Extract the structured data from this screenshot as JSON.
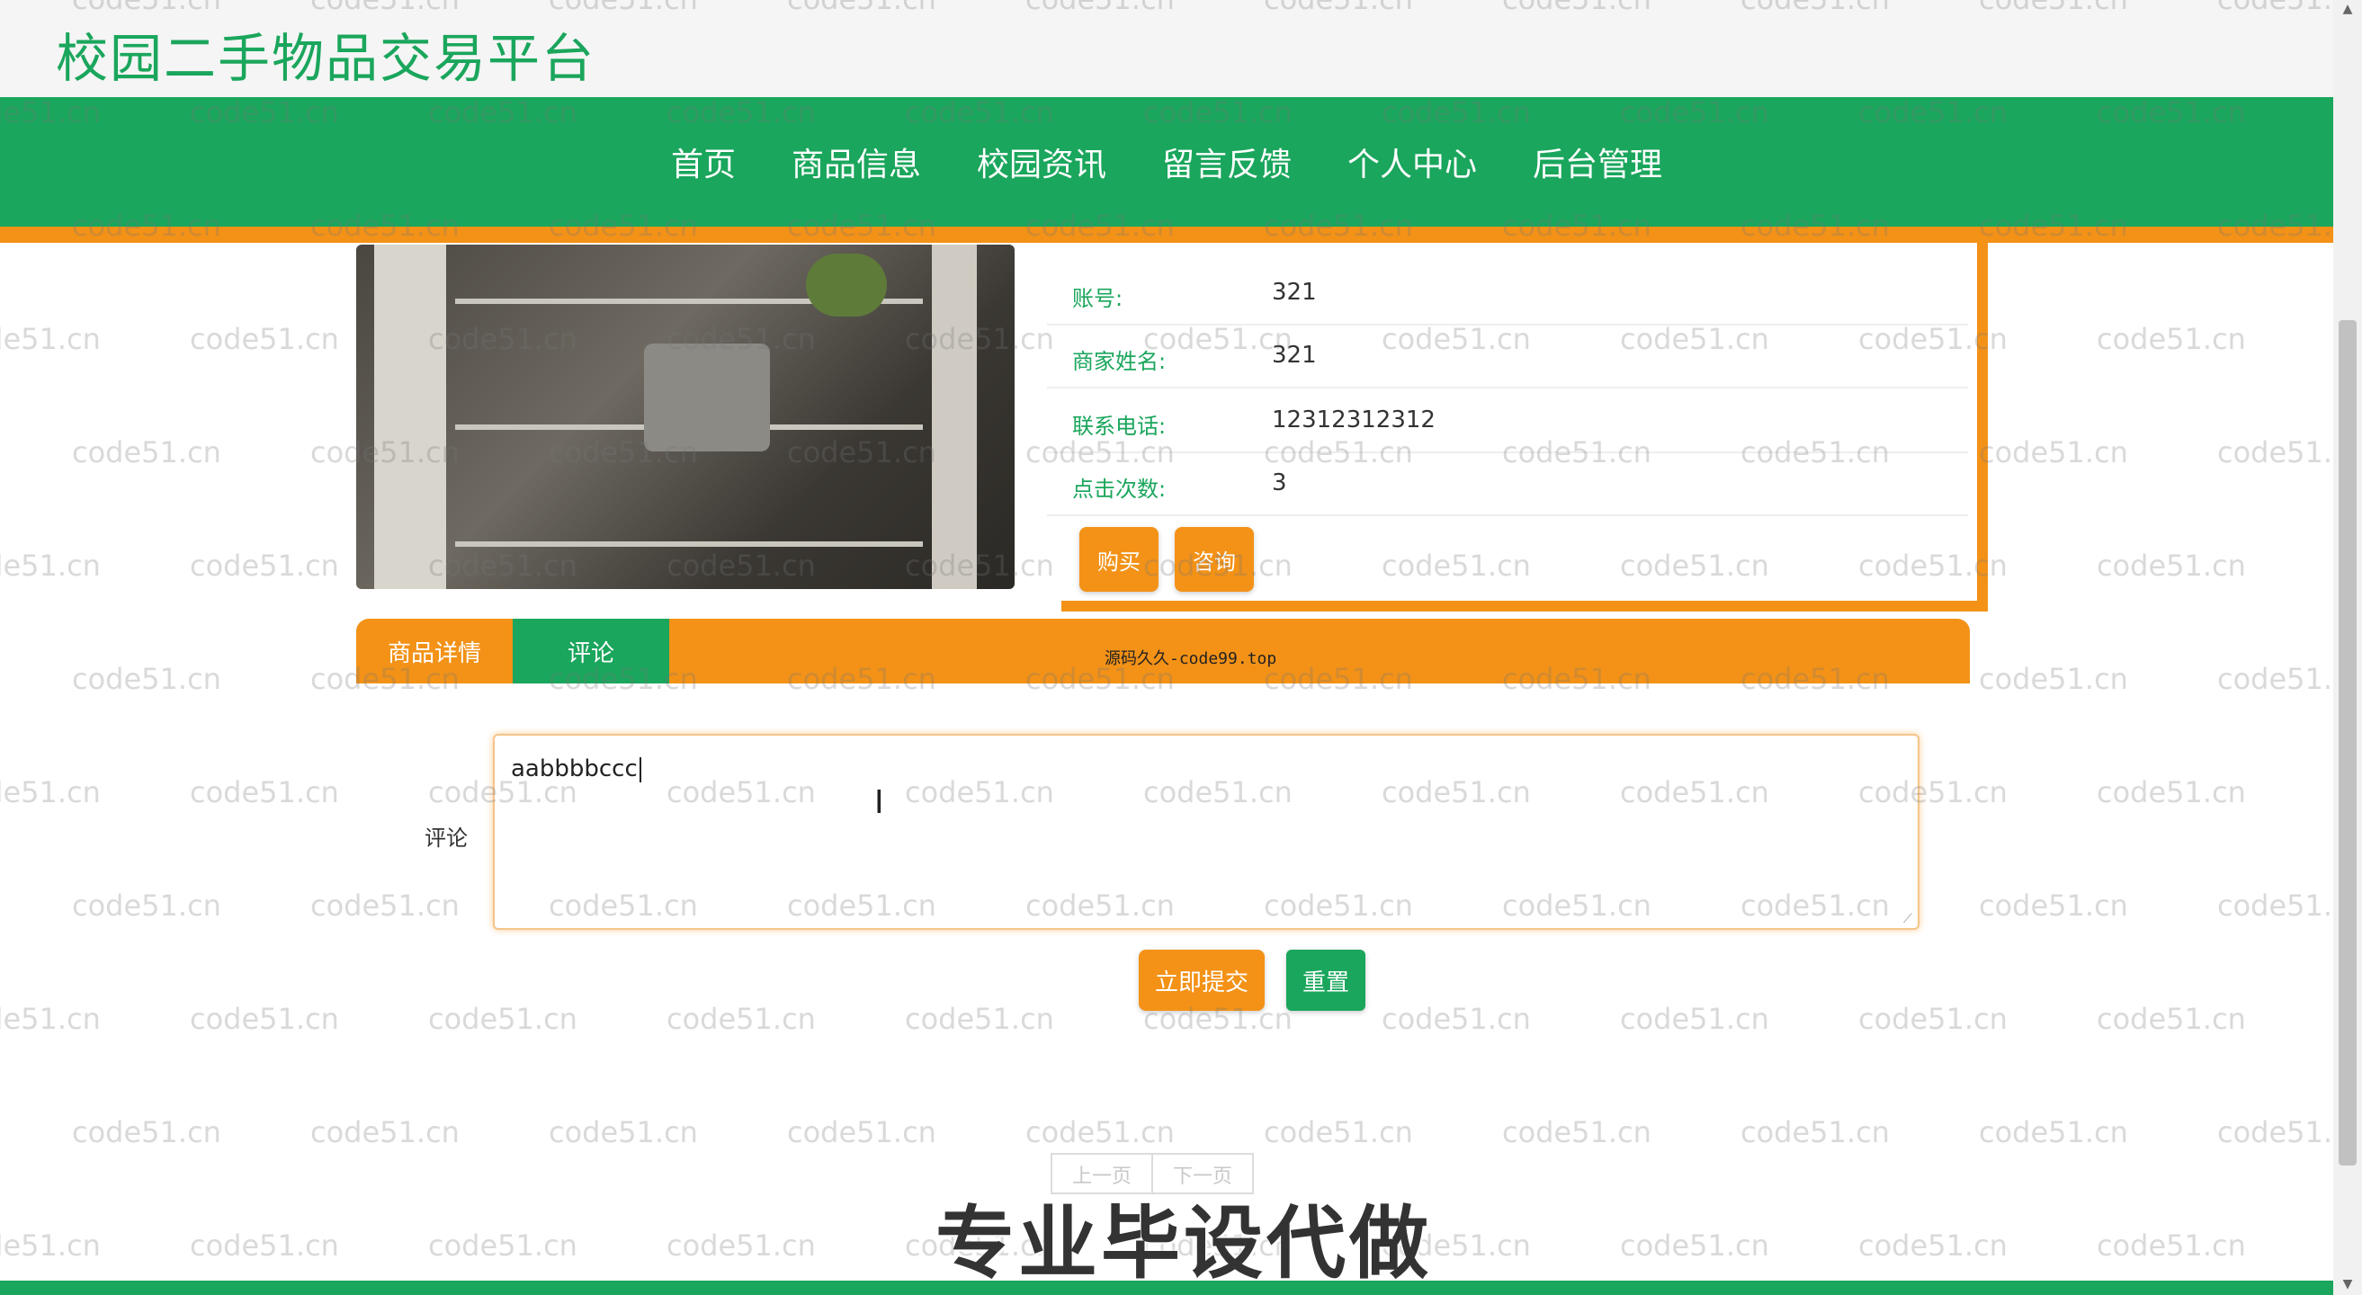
{
  "site": {
    "title": "校园二手物品交易平台"
  },
  "nav": {
    "items": [
      "首页",
      "商品信息",
      "校园资讯",
      "留言反馈",
      "个人中心",
      "后台管理"
    ]
  },
  "product_info": {
    "rows": [
      {
        "label": "账号:",
        "value": "321"
      },
      {
        "label": "商家姓名:",
        "value": "321"
      },
      {
        "label": "联系电话:",
        "value": "12312312312"
      },
      {
        "label": "点击次数:",
        "value": "3"
      }
    ],
    "buy_label": "购买",
    "consult_label": "咨询"
  },
  "tabs": {
    "items": [
      "商品详情",
      "评论"
    ],
    "active": "评论",
    "center_text": "源码久久-code99.top"
  },
  "comment_form": {
    "label": "评论",
    "value": "aabbbbccc",
    "submit_label": "立即提交",
    "reset_label": "重置"
  },
  "pager": {
    "prev": "上一页",
    "next": "下一页"
  },
  "overlay": {
    "banner": "专业毕设代做",
    "watermark": "code51.cn"
  },
  "colors": {
    "primary_green": "#1aa65c",
    "accent_orange": "#f39217"
  },
  "icons": {
    "text_cursor": "ibeam-cursor-icon",
    "resize": "resize-grip-icon"
  }
}
